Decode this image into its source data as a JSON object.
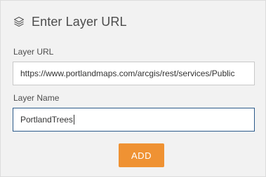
{
  "header": {
    "icon": "layers-icon",
    "title": "Enter Layer URL"
  },
  "layer_url": {
    "label": "Layer URL",
    "value": "https://www.portlandmaps.com/arcgis/rest/services/Public"
  },
  "layer_name": {
    "label": "Layer Name",
    "value": "PortlandTrees"
  },
  "add_button": {
    "label": "ADD",
    "color": "#ef9233"
  },
  "colors": {
    "panel_background": "#f2f2f2",
    "focus_border": "#2b5a8a"
  }
}
